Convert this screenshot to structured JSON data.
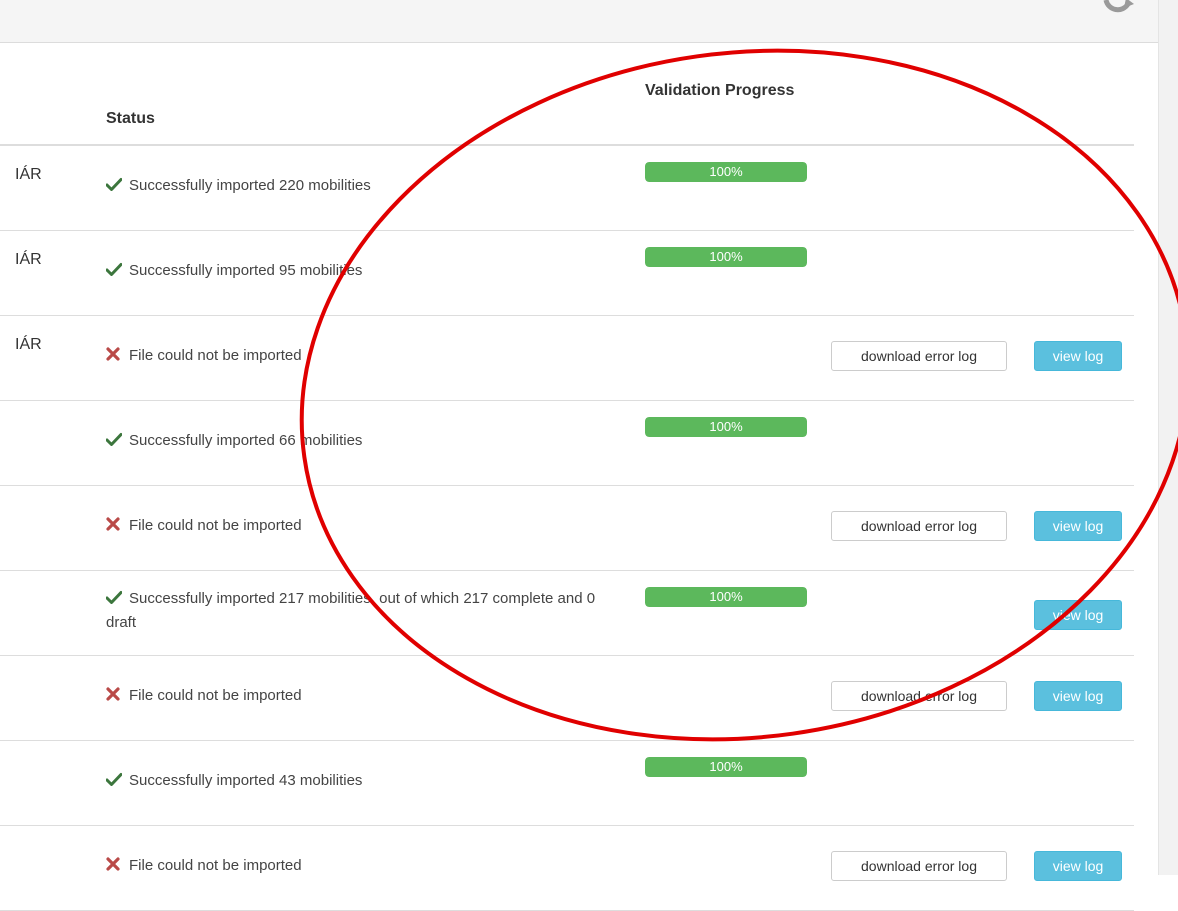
{
  "header": {
    "status_label": "Status",
    "validation_label": "Validation Progress"
  },
  "rows": [
    {
      "name": "IÁR",
      "status_type": "success",
      "status_text": "Successfully imported 220 mobilities",
      "progress_label": "100%",
      "progress_value": 100
    },
    {
      "name": "IÁR",
      "status_type": "success",
      "status_text": "Successfully imported 95 mobilities",
      "progress_label": "100%",
      "progress_value": 100
    },
    {
      "name": "IÁR",
      "status_type": "error",
      "status_text": "File could not be imported",
      "download_label": "download error log",
      "view_label": "view log"
    },
    {
      "name": "",
      "status_type": "success",
      "status_text": "Successfully imported 66 mobilities",
      "progress_label": "100%",
      "progress_value": 100
    },
    {
      "name": "",
      "status_type": "error",
      "status_text": "File could not be imported",
      "download_label": "download error log",
      "view_label": "view log"
    },
    {
      "name": "",
      "status_type": "success",
      "status_text": "Successfully imported 217 mobilities, out of which 217 complete and 0 draft",
      "progress_label": "100%",
      "progress_value": 100,
      "view_label": "view log"
    },
    {
      "name": "",
      "status_type": "error",
      "status_text": "File could not be imported",
      "download_label": "download error log",
      "view_label": "view log"
    },
    {
      "name": "",
      "status_type": "success",
      "status_text": "Successfully imported 43 mobilities",
      "progress_label": "100%",
      "progress_value": 100
    },
    {
      "name": "",
      "status_type": "error",
      "status_text": "File could not be imported",
      "download_label": "download error log",
      "view_label": "view log"
    }
  ],
  "icons": {
    "success": "check-icon",
    "error": "cross-icon",
    "refresh": "refresh-icon"
  },
  "colors": {
    "success_icon": "#3c763d",
    "error_icon": "#b94a48",
    "progress_bar": "#5cb85c",
    "view_button": "#5bc0de",
    "annotation": "#e00000"
  }
}
